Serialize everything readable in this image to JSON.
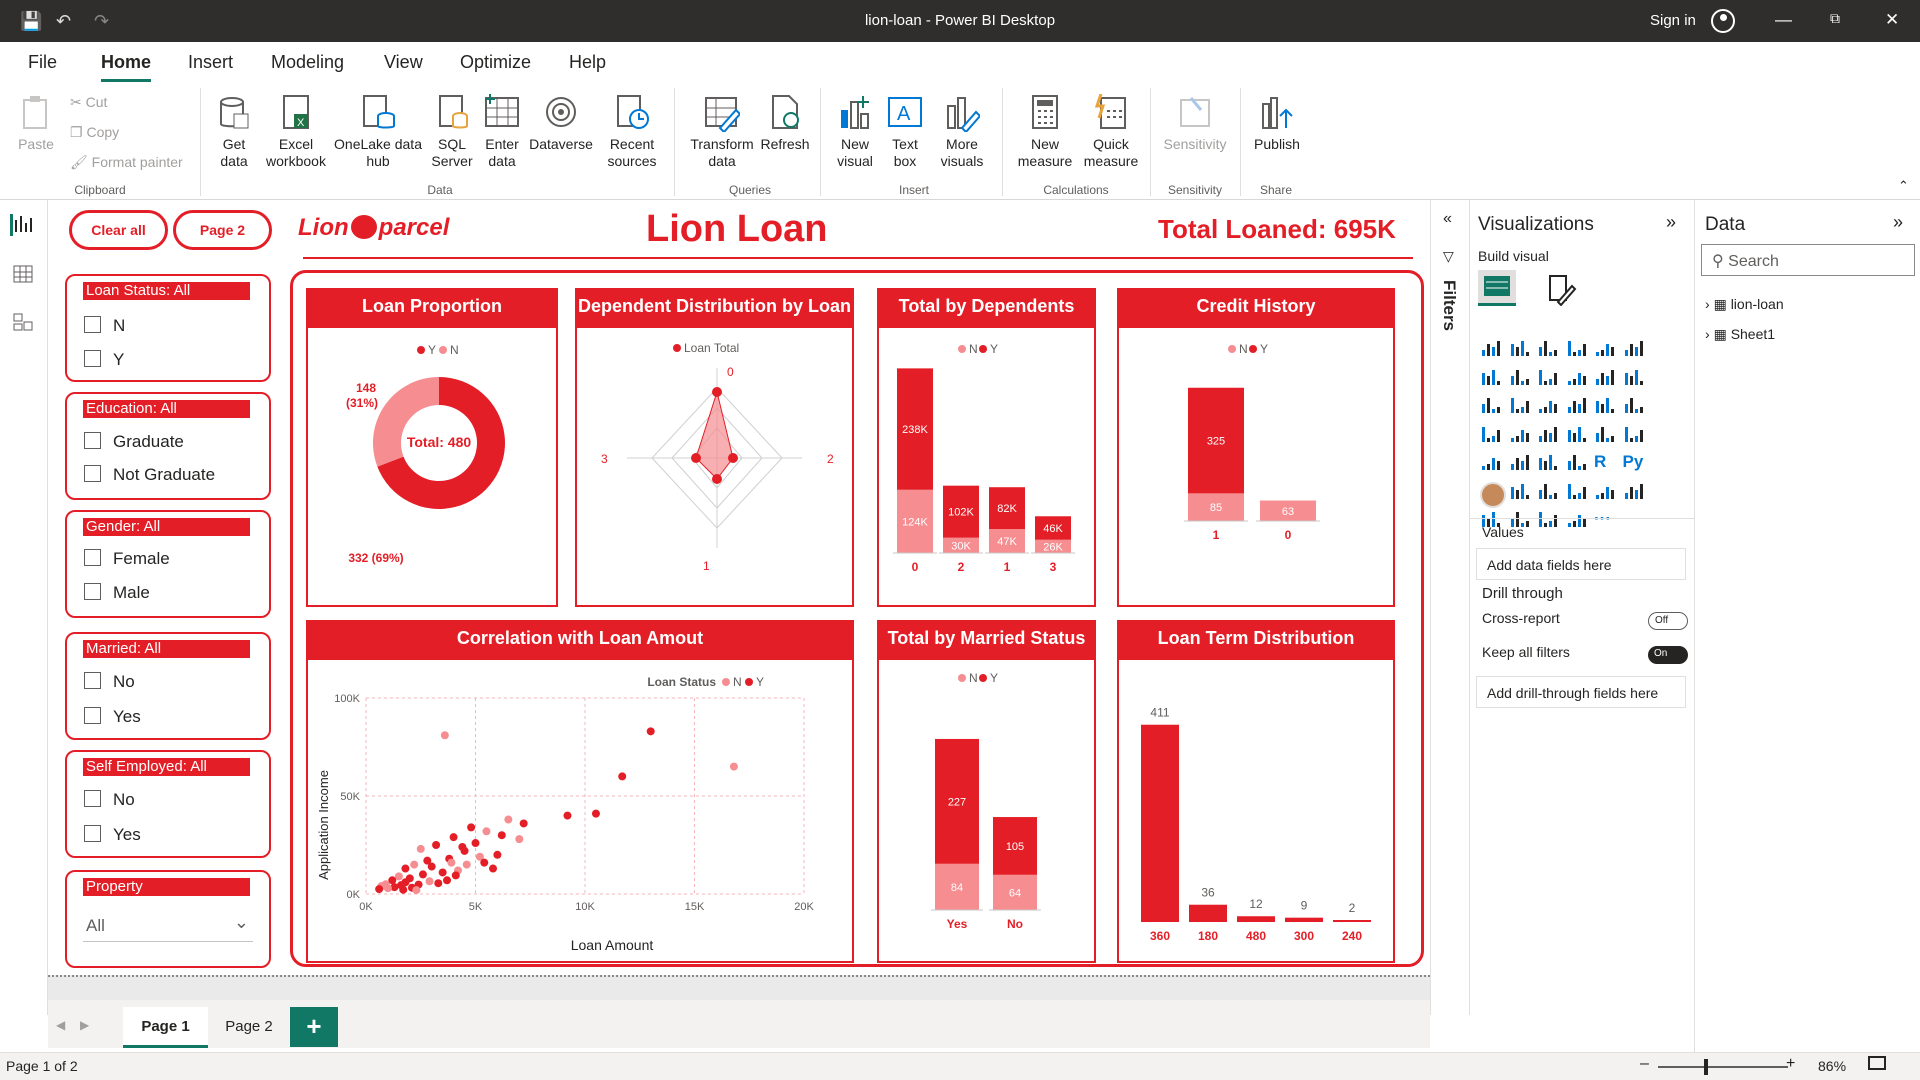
{
  "app": {
    "title": "lion-loan - Power BI Desktop",
    "sign_in": "Sign in"
  },
  "menu": {
    "items": [
      "File",
      "Home",
      "Insert",
      "Modeling",
      "View",
      "Optimize",
      "Help"
    ],
    "active": "Home"
  },
  "ribbon": {
    "clipboard": {
      "paste": "Paste",
      "cut": "Cut",
      "copy": "Copy",
      "format_painter": "Format painter",
      "group": "Clipboard"
    },
    "data": {
      "get_data": "Get data",
      "excel": "Excel workbook",
      "onelake": "OneLake data hub",
      "sql": "SQL Server",
      "enter": "Enter data",
      "dataverse": "Dataverse",
      "recent": "Recent sources",
      "group": "Data"
    },
    "queries": {
      "transform": "Transform data",
      "refresh": "Refresh",
      "group": "Queries"
    },
    "insert": {
      "new_visual": "New visual",
      "text_box": "Text box",
      "more_visuals": "More visuals",
      "group": "Insert"
    },
    "calculations": {
      "new_measure": "New measure",
      "quick_measure": "Quick measure",
      "group": "Calculations"
    },
    "sensitivity": {
      "label": "Sensitivity",
      "group": "Sensitivity"
    },
    "share": {
      "publish": "Publish",
      "group": "Share"
    }
  },
  "report": {
    "clear_all": "Clear all",
    "page2_btn": "Page 2",
    "logo": "Lion parcel",
    "title": "Lion Loan",
    "total_loaned": "Total Loaned:  695K",
    "slicers": [
      {
        "header": "Loan Status: All",
        "options": [
          "N",
          "Y"
        ]
      },
      {
        "header": "Education: All",
        "options": [
          "Graduate",
          "Not Graduate"
        ]
      },
      {
        "header": "Gender: All",
        "options": [
          "Female",
          "Male"
        ]
      },
      {
        "header": "Married: All",
        "options": [
          "No",
          "Yes"
        ]
      },
      {
        "header": "Self Employed: All",
        "options": [
          "No",
          "Yes"
        ]
      },
      {
        "header": "Property",
        "dropdown": "All"
      }
    ],
    "cards": {
      "loan_proportion": {
        "title": "Loan Proportion",
        "legend": [
          "Y",
          "N"
        ],
        "center": "Total: 480",
        "n_label": "148",
        "n_pct": "(31%)",
        "y_label": "332 (69%)"
      },
      "dependent": {
        "title": "Dependent Distribution by Loan",
        "legend": "Loan Total",
        "axes": [
          "0",
          "2",
          "1",
          "3"
        ]
      },
      "total_dependents": {
        "title": "Total by Dependents",
        "legend": [
          "N",
          "Y"
        ]
      },
      "credit": {
        "title": "Credit History",
        "legend": [
          "N",
          "Y"
        ]
      },
      "correlation": {
        "title": "Correlation with Loan Amout",
        "legend_title": "Loan Status",
        "legend": [
          "N",
          "Y"
        ],
        "xlabel": "Loan Amount",
        "ylabel": "Application Income",
        "xticks": [
          "0K",
          "5K",
          "10K",
          "15K",
          "20K"
        ],
        "yticks": [
          "100K",
          "50K",
          "0K"
        ]
      },
      "married": {
        "title": "Total by Married Status",
        "legend": [
          "N",
          "Y"
        ]
      },
      "loan_term": {
        "title": "Loan Term Distribution"
      }
    }
  },
  "chart_data": [
    {
      "type": "pie",
      "title": "Loan Proportion",
      "labels": [
        "Y",
        "N"
      ],
      "values": [
        332,
        148
      ],
      "percent": [
        69,
        31
      ]
    },
    {
      "type": "bar",
      "title": "Total by Dependents",
      "categories": [
        "0",
        "2",
        "1",
        "3"
      ],
      "series": [
        {
          "name": "Y",
          "values": [
            238,
            102,
            82,
            46
          ],
          "labels": [
            "238K",
            "102K",
            "82K",
            "46K"
          ]
        },
        {
          "name": "N",
          "values": [
            124,
            30,
            47,
            26
          ],
          "labels": [
            "124K",
            "30K",
            "47K",
            "26K"
          ]
        }
      ]
    },
    {
      "type": "bar",
      "title": "Credit History",
      "categories": [
        "1",
        "0"
      ],
      "series": [
        {
          "name": "Y",
          "values": [
            325,
            0
          ]
        },
        {
          "name": "N",
          "values": [
            85,
            63
          ]
        }
      ]
    },
    {
      "type": "bar",
      "title": "Total by Married Status",
      "categories": [
        "Yes",
        "No"
      ],
      "series": [
        {
          "name": "Y",
          "values": [
            227,
            105
          ]
        },
        {
          "name": "N",
          "values": [
            84,
            64
          ]
        }
      ]
    },
    {
      "type": "bar",
      "title": "Loan Term Distribution",
      "categories": [
        "360",
        "180",
        "480",
        "300",
        "240"
      ],
      "values": [
        411,
        36,
        12,
        9,
        2
      ]
    },
    {
      "type": "scatter",
      "title": "Correlation with Loan Amout",
      "xlabel": "Loan Amount",
      "ylabel": "Application Income",
      "xlim": [
        0,
        20000
      ],
      "ylim": [
        0,
        100000
      ],
      "points": [
        [
          3600,
          81000
        ],
        [
          13000,
          83000
        ],
        [
          11700,
          60000
        ],
        [
          16800,
          65000
        ],
        [
          10500,
          41000
        ],
        [
          9200,
          40000
        ],
        [
          6500,
          38000
        ],
        [
          7200,
          36000
        ],
        [
          4800,
          34000
        ],
        [
          5500,
          32000
        ],
        [
          6200,
          30000
        ],
        [
          4000,
          29000
        ],
        [
          7000,
          28000
        ],
        [
          5000,
          26000
        ],
        [
          3200,
          25000
        ],
        [
          2500,
          23000
        ],
        [
          4500,
          22000
        ],
        [
          6000,
          20000
        ],
        [
          5200,
          19000
        ],
        [
          3800,
          18000
        ],
        [
          2800,
          17000
        ],
        [
          2200,
          15000
        ],
        [
          3000,
          14000
        ],
        [
          1800,
          13000
        ],
        [
          4200,
          12000
        ],
        [
          3500,
          11000
        ],
        [
          2600,
          10000
        ],
        [
          1500,
          9000
        ],
        [
          2000,
          8000
        ],
        [
          1200,
          7000
        ],
        [
          2900,
          6500
        ],
        [
          1800,
          6000
        ],
        [
          3300,
          5500
        ],
        [
          900,
          5000
        ],
        [
          2400,
          4800
        ],
        [
          1600,
          4500
        ],
        [
          700,
          4000
        ],
        [
          1300,
          3500
        ],
        [
          2100,
          3200
        ],
        [
          1000,
          3000
        ],
        [
          600,
          2500
        ],
        [
          1700,
          2200
        ],
        [
          2300,
          2000
        ],
        [
          3700,
          7000
        ],
        [
          4100,
          9500
        ],
        [
          4600,
          15000
        ],
        [
          5400,
          16000
        ],
        [
          5800,
          13000
        ],
        [
          3900,
          16000
        ],
        [
          4400,
          24000
        ]
      ]
    }
  ],
  "bottom": {
    "tabs": [
      "Page 1",
      "Page 2"
    ],
    "active": "Page 1",
    "status": "Page 1 of 2",
    "zoom": "86%"
  },
  "viz_pane": {
    "title": "Visualizations",
    "build": "Build visual",
    "values": "Values",
    "values_field": "Add data fields here",
    "drill": "Drill through",
    "cross": "Cross-report",
    "cross_state": "Off",
    "keep": "Keep all filters",
    "keep_state": "On",
    "drill_field": "Add drill-through fields here"
  },
  "data_pane": {
    "title": "Data",
    "search": "Search",
    "tables": [
      "lion-loan",
      "Sheet1"
    ]
  },
  "filters": "Filters",
  "colors": {
    "red": "#e31e26",
    "pink": "#f58d91",
    "teal": "#117865"
  }
}
